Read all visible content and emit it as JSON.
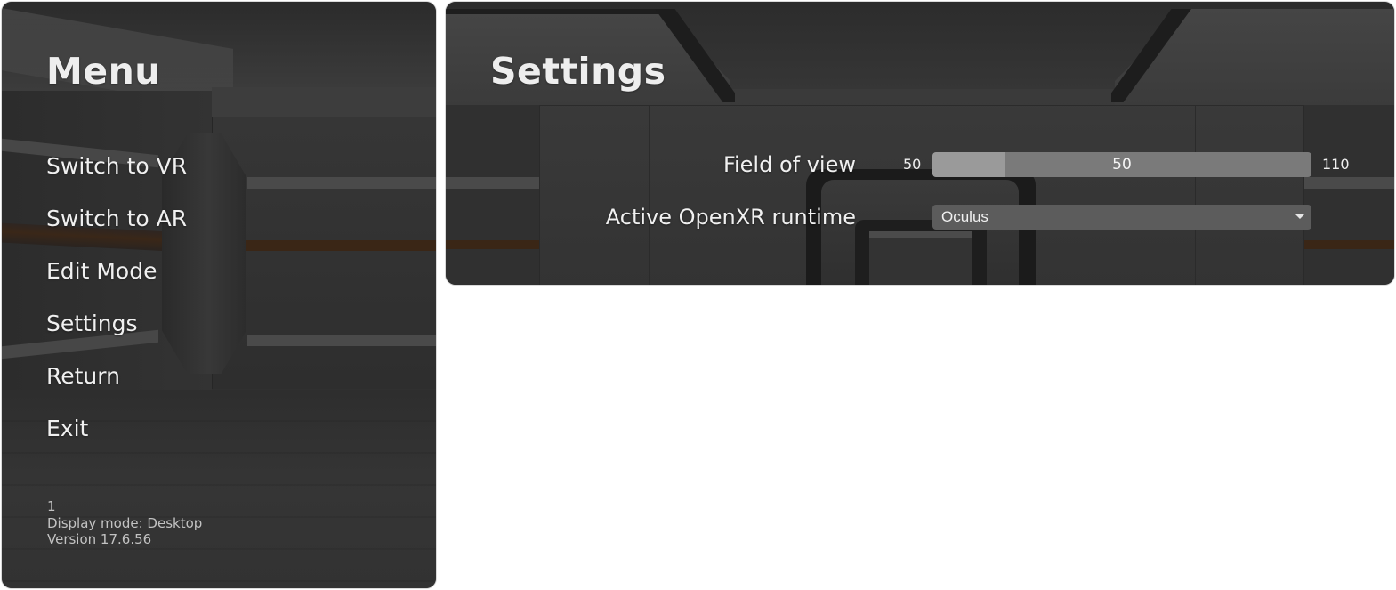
{
  "menu": {
    "title": "Menu",
    "items": [
      {
        "label": "Switch to VR"
      },
      {
        "label": "Switch to AR"
      },
      {
        "label": "Edit Mode"
      },
      {
        "label": "Settings"
      },
      {
        "label": "Return"
      },
      {
        "label": "Exit"
      }
    ],
    "footer": {
      "line1": "1",
      "display_mode": "Display mode: Desktop",
      "version": "Version 17.6.56"
    }
  },
  "settings": {
    "title": "Settings",
    "field_of_view": {
      "label": "Field of view",
      "min": "50",
      "max": "110",
      "value": "50",
      "fill_fraction": 0.19
    },
    "openxr_runtime": {
      "label": "Active OpenXR runtime",
      "selected": "Oculus",
      "icon": "chevron-down-icon"
    }
  }
}
